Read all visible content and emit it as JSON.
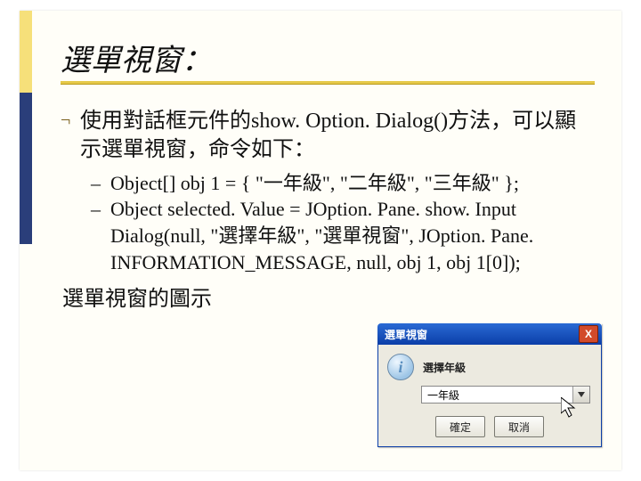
{
  "title": "選單視窗：",
  "bullet": "¬",
  "main_text": "使用對話框元件的show. Option. Dialog()方法，可以顯示選單視窗，命令如下：",
  "subs": [
    "Object[] obj 1 = { \"一年級\", \"二年級\", \"三年級\" };",
    "Object selected. Value = JOption. Pane. show. Input"
  ],
  "sub_cont": "Dialog(null, \"選擇年級\", \"選單視窗\", JOption. Pane. INFORMATION_MESSAGE, null, obj 1, obj 1[0]);",
  "caption": "選單視窗的圖示",
  "dialog": {
    "title": "選單視窗",
    "close": "X",
    "label": "選擇年級",
    "combo_value": "一年級",
    "ok": "確定",
    "cancel": "取消",
    "info_glyph": "i"
  }
}
